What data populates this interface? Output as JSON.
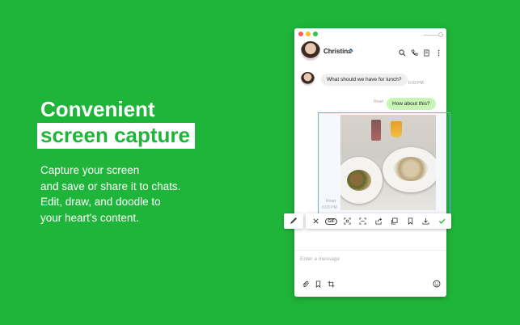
{
  "headline": {
    "line1": "Convenient",
    "line2": "screen capture"
  },
  "description": {
    "line1": "Capture your screen",
    "line2": "and save or share it to chats.",
    "line3": "Edit, draw, and doodle to",
    "line4": "your heart's content."
  },
  "window": {
    "traffic_lights": [
      "#ff5f57",
      "#febc2e",
      "#28c840"
    ]
  },
  "chat_header": {
    "contact_name": "Christina",
    "icons": [
      "search-icon",
      "phone-icon",
      "note-icon",
      "more-icon"
    ]
  },
  "messages": [
    {
      "direction": "in",
      "text": "What should we have for lunch?",
      "time": "6:03 PM"
    },
    {
      "direction": "out",
      "text": "How about this?",
      "status": "Read"
    }
  ],
  "capture": {
    "status": "Read",
    "time": "6:03 PM"
  },
  "capture_toolbar": {
    "gif_label": "GIF",
    "tools": [
      "close-icon",
      "gif-icon",
      "area-select-icon",
      "window-select-icon",
      "share-icon",
      "copy-icon",
      "bookmark-icon",
      "download-icon",
      "confirm-icon"
    ],
    "accent": "#1fb53a"
  },
  "input": {
    "placeholder": "Enter a message"
  },
  "colors": {
    "background": "#1fb53a",
    "outgoing_bubble": "#c9f5b4",
    "incoming_bubble": "#efefef"
  }
}
